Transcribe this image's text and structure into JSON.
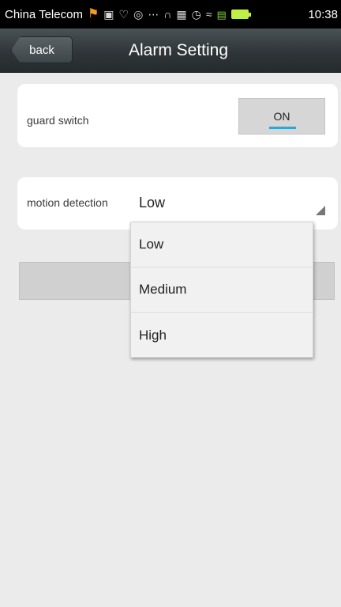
{
  "status_bar": {
    "carrier": "China Telecom",
    "time": "10:38",
    "icons": [
      "flag-icon",
      "image-icon",
      "heart-icon",
      "message-icon",
      "more-icon",
      "headset-icon",
      "screen-icon",
      "alarm-icon",
      "wifi-icon",
      "signal-icon",
      "battery-icon"
    ]
  },
  "header": {
    "back_label": "back",
    "title": "Alarm Setting"
  },
  "guard": {
    "label": "guard switch",
    "toggle_label": "ON",
    "accent_color": "#2fa6d8"
  },
  "motion": {
    "label": "motion detection",
    "selected": "Low"
  },
  "dropdown": {
    "options": [
      "Low",
      "Medium",
      "High"
    ]
  }
}
